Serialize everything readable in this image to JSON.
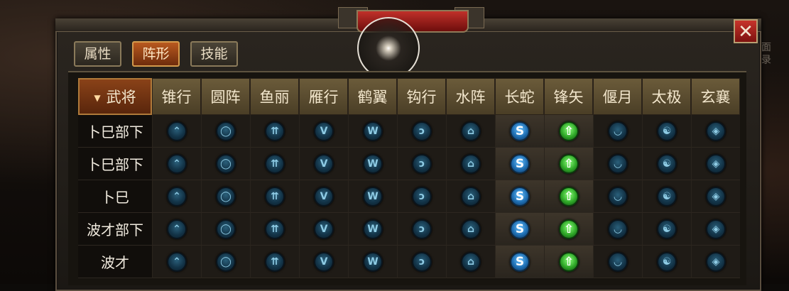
{
  "header": {
    "close_label": "✕",
    "side_text": "面\n录"
  },
  "tabs": [
    {
      "label": "属性",
      "active": false
    },
    {
      "label": "阵形",
      "active": true
    },
    {
      "label": "技能",
      "active": false
    }
  ],
  "table": {
    "first_header": "武将",
    "columns": [
      "锥行",
      "圆阵",
      "鱼丽",
      "雁行",
      "鹤翼",
      "钩行",
      "水阵",
      "长蛇",
      "锋矢",
      "偃月",
      "太极",
      "玄襄"
    ],
    "icons": [
      {
        "name": "chevron-up-icon",
        "glyph": "⌃",
        "style": "blue"
      },
      {
        "name": "circle-ring-icon",
        "glyph": "◯",
        "style": "blue"
      },
      {
        "name": "double-chevron-icon",
        "glyph": "⇈",
        "style": "blue"
      },
      {
        "name": "v-shape-icon",
        "glyph": "V",
        "style": "blue"
      },
      {
        "name": "w-shape-icon",
        "glyph": "W",
        "style": "blue"
      },
      {
        "name": "hook-icon",
        "glyph": "ↄ",
        "style": "blue"
      },
      {
        "name": "house-icon",
        "glyph": "⌂",
        "style": "blue"
      },
      {
        "name": "snake-s-icon",
        "glyph": "S",
        "style": "bright-blue"
      },
      {
        "name": "arrow-up-icon",
        "glyph": "⇧",
        "style": "green"
      },
      {
        "name": "crescent-icon",
        "glyph": "◡",
        "style": "blue"
      },
      {
        "name": "taiji-icon",
        "glyph": "☯",
        "style": "blue"
      },
      {
        "name": "diamond-icon",
        "glyph": "◈",
        "style": "blue"
      }
    ],
    "highlight_columns": [
      7,
      8
    ],
    "rows": [
      {
        "name": "卜巳部下"
      },
      {
        "name": "卜巳部下"
      },
      {
        "name": "卜巳"
      },
      {
        "name": "波才部下"
      },
      {
        "name": "波才"
      }
    ]
  }
}
